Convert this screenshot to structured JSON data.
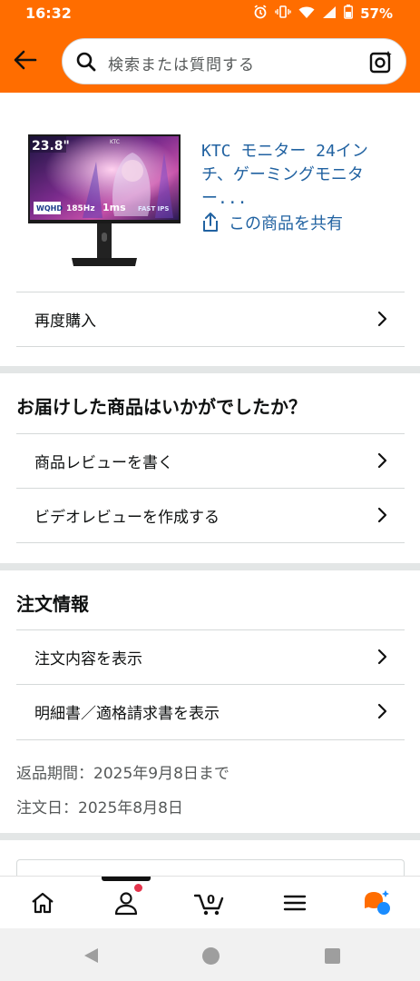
{
  "status_bar": {
    "time": "16:32",
    "battery": "57%"
  },
  "header": {
    "search_placeholder": "検索または質問する"
  },
  "product": {
    "title": "KTC モニター 24インチ、ゲーミングモニター...",
    "share_label": "この商品を共有",
    "image_text": {
      "size": "23.8\"",
      "brand": "KTC",
      "res": "WQHD",
      "hz": "185Hz",
      "ms": "1ms",
      "ips": "FAST IPS"
    }
  },
  "rebuy": {
    "label": "再度購入"
  },
  "review_section": {
    "title": "お届けした商品はいかがでしたか？",
    "items": [
      {
        "label": "商品レビューを書く"
      },
      {
        "label": "ビデオレビューを作成する"
      }
    ]
  },
  "order_section": {
    "title": "注文情報",
    "items": [
      {
        "label": "注文内容を表示"
      },
      {
        "label": "明細書／適格請求書を表示"
      }
    ],
    "return_period": "返品期間：2025年9月8日まで",
    "order_date": "注文日：2025年8月8日"
  },
  "bottom_nav": {
    "cart_count": "0",
    "accent_color": "#ff6d00"
  }
}
